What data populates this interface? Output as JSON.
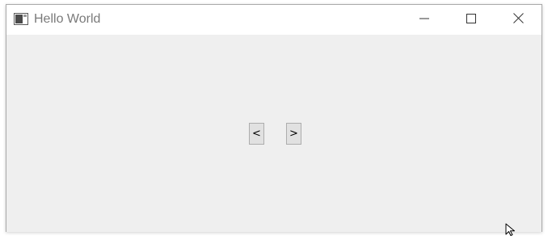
{
  "window": {
    "title": "Hello World",
    "icon": "app-window-icon",
    "controls": {
      "minimize": "minimize-icon",
      "maximize": "maximize-icon",
      "close": "close-icon"
    }
  },
  "content": {
    "prev_label": "<",
    "next_label": ">"
  },
  "colors": {
    "titlebar_bg": "#ffffff",
    "client_bg": "#efefef",
    "title_text": "#7a7a7a",
    "button_bg": "#e1e1e1",
    "button_border": "#adadad"
  }
}
